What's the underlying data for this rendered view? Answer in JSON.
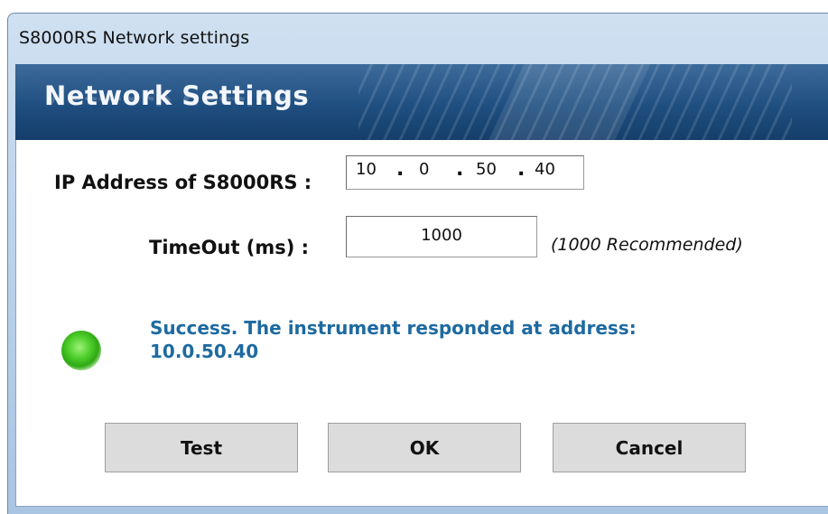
{
  "window": {
    "title": "S8000RS Network settings"
  },
  "banner": {
    "title": "Network Settings"
  },
  "form": {
    "ip_label": "IP Address of S8000RS :",
    "ip_octets": [
      "10",
      "0",
      "50",
      "40"
    ],
    "ip_separator": ".",
    "timeout_label": "TimeOut (ms) :",
    "timeout_value": "1000",
    "timeout_hint": "(1000 Recommended)"
  },
  "status": {
    "line1": "Success. The instrument responded at address:",
    "line2": "10.0.50.40",
    "indicator_color": "#4fcf2c",
    "text_color": "#1e6aa0"
  },
  "buttons": {
    "test": "Test",
    "ok": "OK",
    "cancel": "Cancel"
  }
}
